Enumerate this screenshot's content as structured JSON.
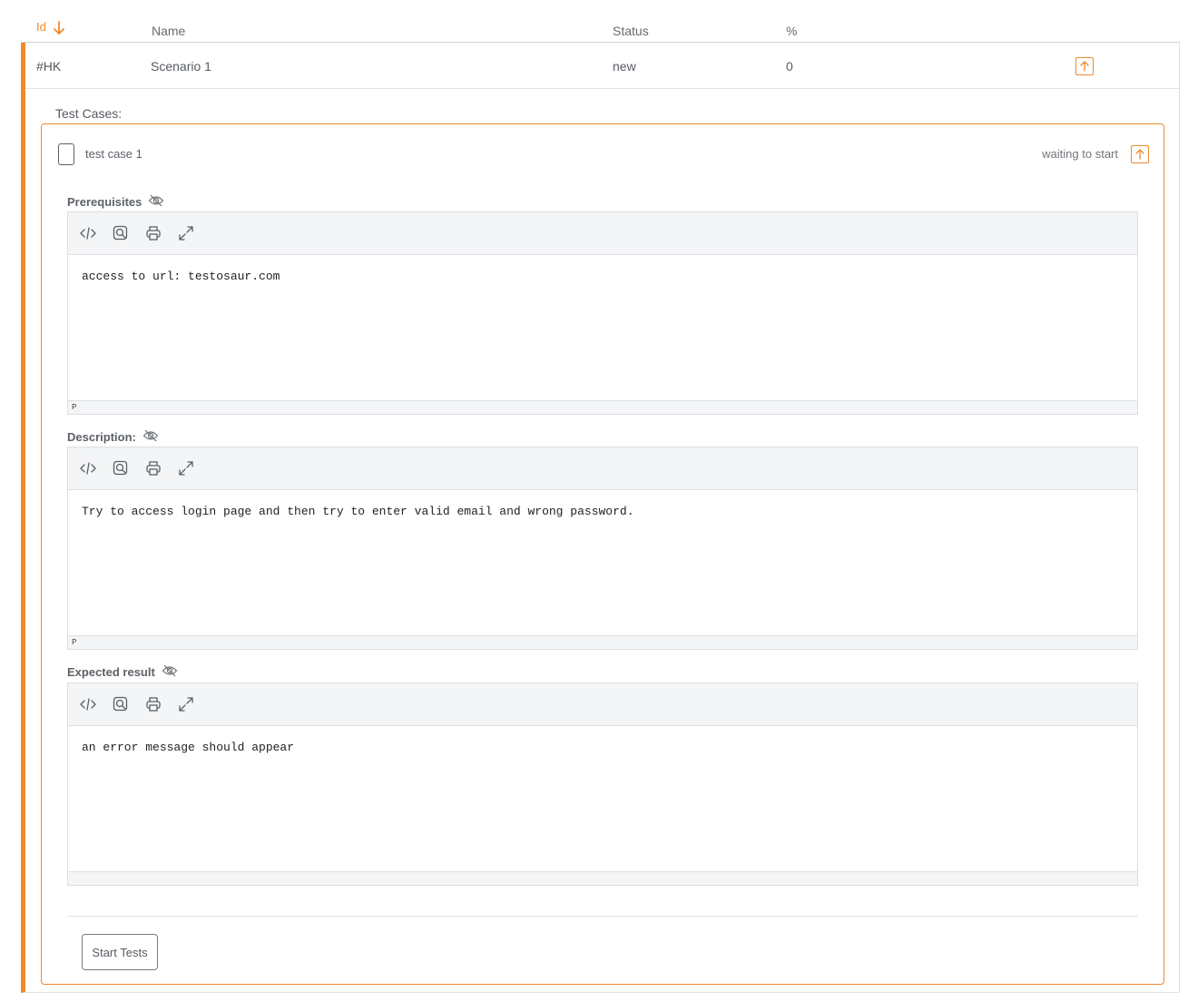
{
  "table_header": {
    "id": "Id",
    "name": "Name",
    "status": "Status",
    "percent": "%"
  },
  "scenario": {
    "id": "#HK",
    "name": "Scenario 1",
    "status": "new",
    "percent": "0"
  },
  "test_cases_label": "Test Cases:",
  "test_case": {
    "name": "test case 1",
    "status": "waiting to start",
    "sections": [
      {
        "label": "Prerequisites",
        "content": "access to url: testosaur.com",
        "statusbar": "P"
      },
      {
        "label": "Description:",
        "content": "Try to access login page and then try to enter valid email and wrong password.",
        "statusbar": "P"
      },
      {
        "label": "Expected result",
        "content": "an error message should appear",
        "statusbar": ""
      }
    ]
  },
  "start_button": "Start Tests",
  "colors": {
    "accent": "#f08a2c",
    "border": "#e0e2e4",
    "toolbar_bg": "#f4f5f6"
  },
  "icons": [
    "sort-down-arrow-icon",
    "upload-icon",
    "eye-off-icon",
    "code-icon",
    "search-icon",
    "print-icon",
    "fullscreen-icon"
  ]
}
